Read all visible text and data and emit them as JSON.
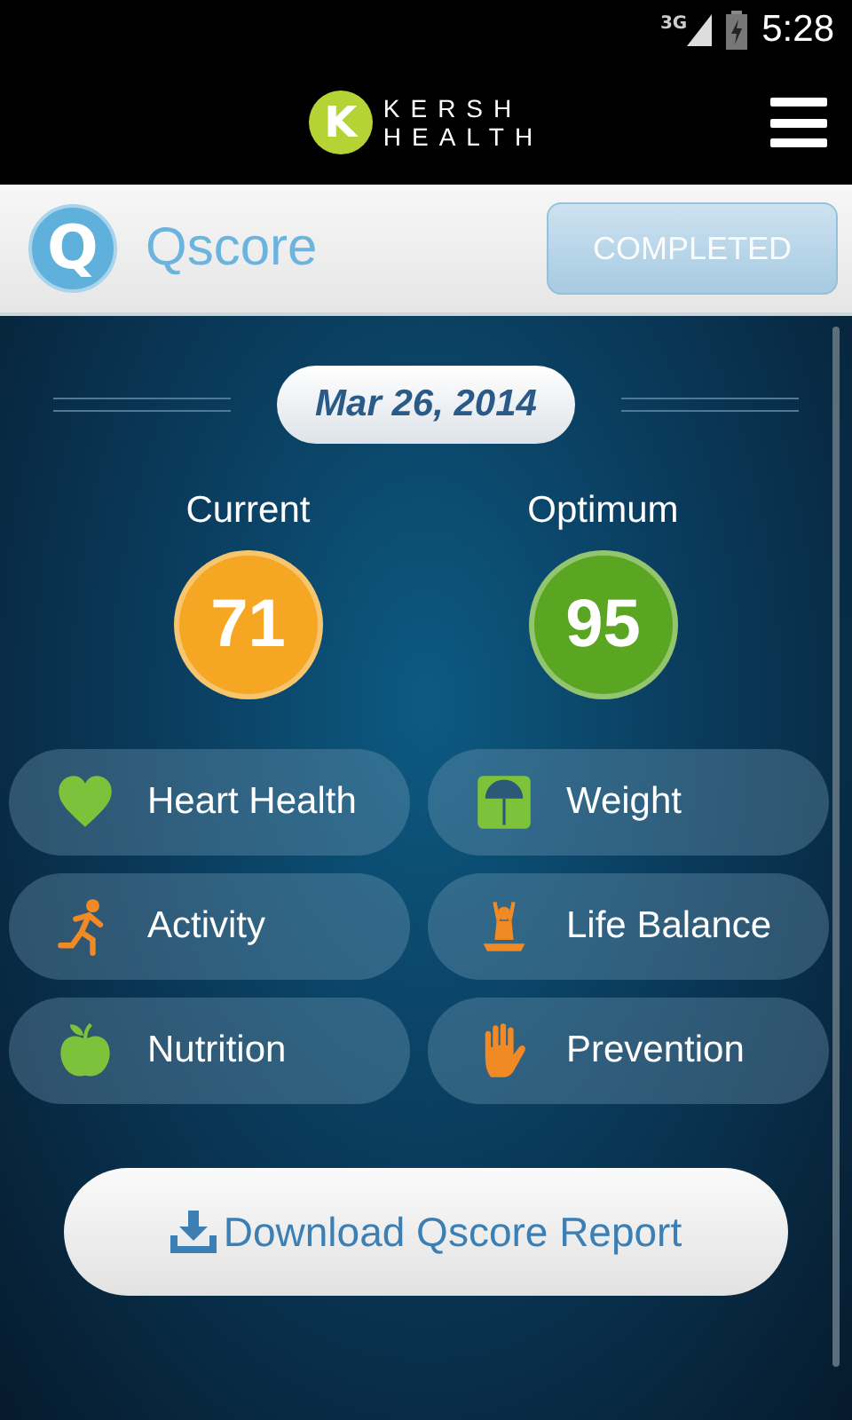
{
  "status_bar": {
    "network": "3G",
    "time": "5:28"
  },
  "header": {
    "logo_letter": "K",
    "logo_lines": [
      "KERSH",
      "HEALTH"
    ]
  },
  "title_bar": {
    "icon_letter": "Q",
    "title": "Qscore",
    "status_button": {
      "label": "COMPLETED",
      "disabled": true
    }
  },
  "date": "Mar 26, 2014",
  "scores": [
    {
      "label": "Current",
      "value": "71",
      "color": "#f5a623"
    },
    {
      "label": "Optimum",
      "value": "95",
      "color": "#5aa623"
    }
  ],
  "categories": [
    {
      "label": "Heart Health",
      "kind": "heart"
    },
    {
      "label": "Weight",
      "kind": "scale"
    },
    {
      "label": "Activity",
      "kind": "runner"
    },
    {
      "label": "Life Balance",
      "kind": "yoga"
    },
    {
      "label": "Nutrition",
      "kind": "apple"
    },
    {
      "label": "Prevention",
      "kind": "hand"
    }
  ],
  "download_button": {
    "label": "Download Qscore Report"
  }
}
